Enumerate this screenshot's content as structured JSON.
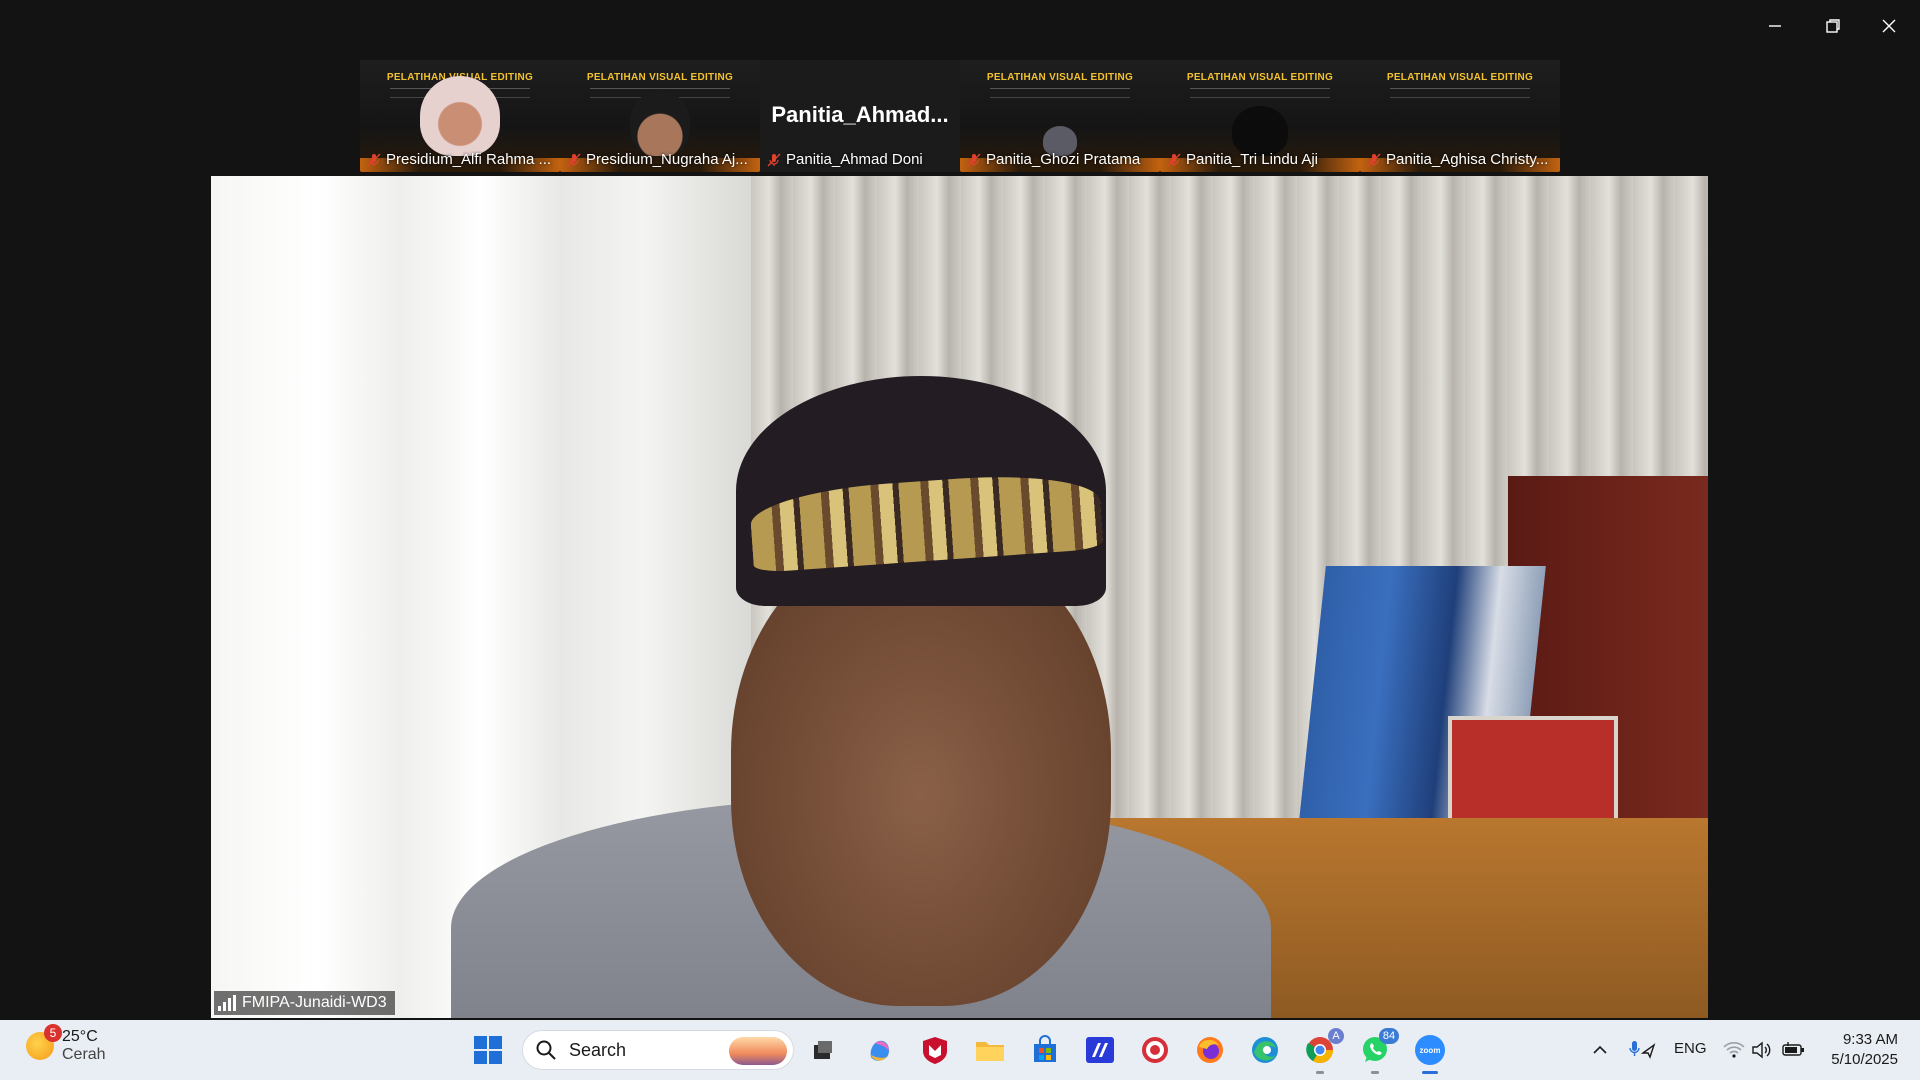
{
  "window": {
    "controls": [
      {
        "name": "minimize",
        "icon": "minimize-icon"
      },
      {
        "name": "restore",
        "icon": "restore-icon"
      },
      {
        "name": "close",
        "icon": "close-icon"
      }
    ]
  },
  "gallery": {
    "banner_title": "PELATIHAN VISUAL EDITING",
    "participants": [
      {
        "name": "Presidium_Alfi Rahma ...",
        "muted": true,
        "kind": "video"
      },
      {
        "name": "Presidium_Nugraha Aj...",
        "muted": true,
        "kind": "video"
      },
      {
        "name": "Panitia_Ahmad Doni",
        "muted": true,
        "kind": "name",
        "display_name": "Panitia_Ahmad..."
      },
      {
        "name": "Panitia_Ghozi Pratama",
        "muted": true,
        "kind": "video"
      },
      {
        "name": "Panitia_Tri Lindu Aji",
        "muted": true,
        "kind": "video"
      },
      {
        "name": "Panitia_Aghisa Christy...",
        "muted": true,
        "kind": "video"
      }
    ]
  },
  "main_video": {
    "speaker_name": "FMIPA-Junaidi-WD3"
  },
  "taskbar": {
    "weather": {
      "temp": "25°C",
      "condition": "Cerah",
      "badge": "5"
    },
    "search_placeholder": "Search",
    "apps": [
      {
        "name": "task-view",
        "icon": "task-view-icon"
      },
      {
        "name": "copilot",
        "icon": "copilot-icon"
      },
      {
        "name": "mcafee",
        "icon": "shield-icon"
      },
      {
        "name": "file-explorer",
        "icon": "folder-icon"
      },
      {
        "name": "microsoft-store",
        "icon": "store-icon"
      },
      {
        "name": "app-blue",
        "icon": "app-icon"
      },
      {
        "name": "app-target",
        "icon": "target-icon"
      },
      {
        "name": "firefox",
        "icon": "firefox-icon"
      },
      {
        "name": "edge",
        "icon": "edge-icon"
      },
      {
        "name": "chrome",
        "icon": "chrome-icon"
      },
      {
        "name": "whatsapp",
        "icon": "whatsapp-icon",
        "badge": "84"
      },
      {
        "name": "zoom",
        "icon": "zoom-icon",
        "label": "zoom"
      }
    ],
    "language": "ENG",
    "time": "9:33 AM",
    "date": "5/10/2025"
  },
  "colors": {
    "background": "#131313",
    "taskbar": "#e9eef4",
    "accent": "#2b6fd6",
    "banner_title": "#f4c12e",
    "mic_muted": "#e0412f"
  }
}
